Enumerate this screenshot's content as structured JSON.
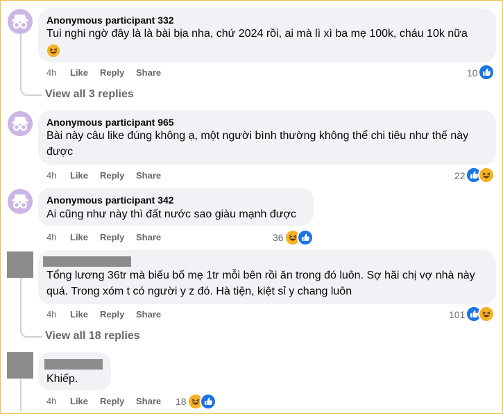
{
  "comments": [
    {
      "author": "Anonymous participant 332",
      "text": "Tui nghi ngờ đây là là bài bịa nha, chứ 2024 rồi, ai mà lì xì ba mẹ 100k, cháu 10k nữa",
      "time": "4h",
      "like": "Like",
      "reply": "Reply",
      "share": "Share",
      "reaction_count": "10",
      "reactions": [
        "like-icon"
      ],
      "view_replies": "View all 3 replies"
    },
    {
      "author": "Anonymous participant 965",
      "text": "Bài này câu like đúng không ạ, một người bình thường không thể chi tiêu như thế này được",
      "time": "4h",
      "like": "Like",
      "reply": "Reply",
      "share": "Share",
      "reaction_count": "22",
      "reactions": [
        "like-icon",
        "haha-icon"
      ]
    },
    {
      "author": "Anonymous participant 342",
      "text": "Ai cũng như này thì đất nước sao giàu mạnh được",
      "time": "4h",
      "like": "Like",
      "reply": "Reply",
      "share": "Share",
      "reaction_count": "36",
      "reactions": [
        "haha-icon",
        "like-icon"
      ]
    },
    {
      "author": "",
      "text": "Tổng lương 36tr mà biếu bố mẹ 1tr mỗi bên rồi ăn trong đó luôn. Sợ hãi chị vợ nhà này quá. Trong xóm t có người y z đó. Hà tiện, kiệt sỉ y chang luôn",
      "time": "4h",
      "like": "Like",
      "reply": "Reply",
      "share": "Share",
      "reaction_count": "101",
      "reactions": [
        "like-icon",
        "haha-icon"
      ],
      "view_replies": "View all 18 replies"
    },
    {
      "author": "",
      "text": "Khiếp.",
      "time": "4h",
      "like": "Like",
      "reply": "Reply",
      "share": "Share",
      "reaction_count": "18",
      "reactions": [
        "haha-icon",
        "like-icon"
      ]
    }
  ],
  "colors": {
    "like": "#1b74e4",
    "haha": "#f7b125",
    "bubble": "#f0f2f5",
    "secondary_text": "#65676b"
  }
}
